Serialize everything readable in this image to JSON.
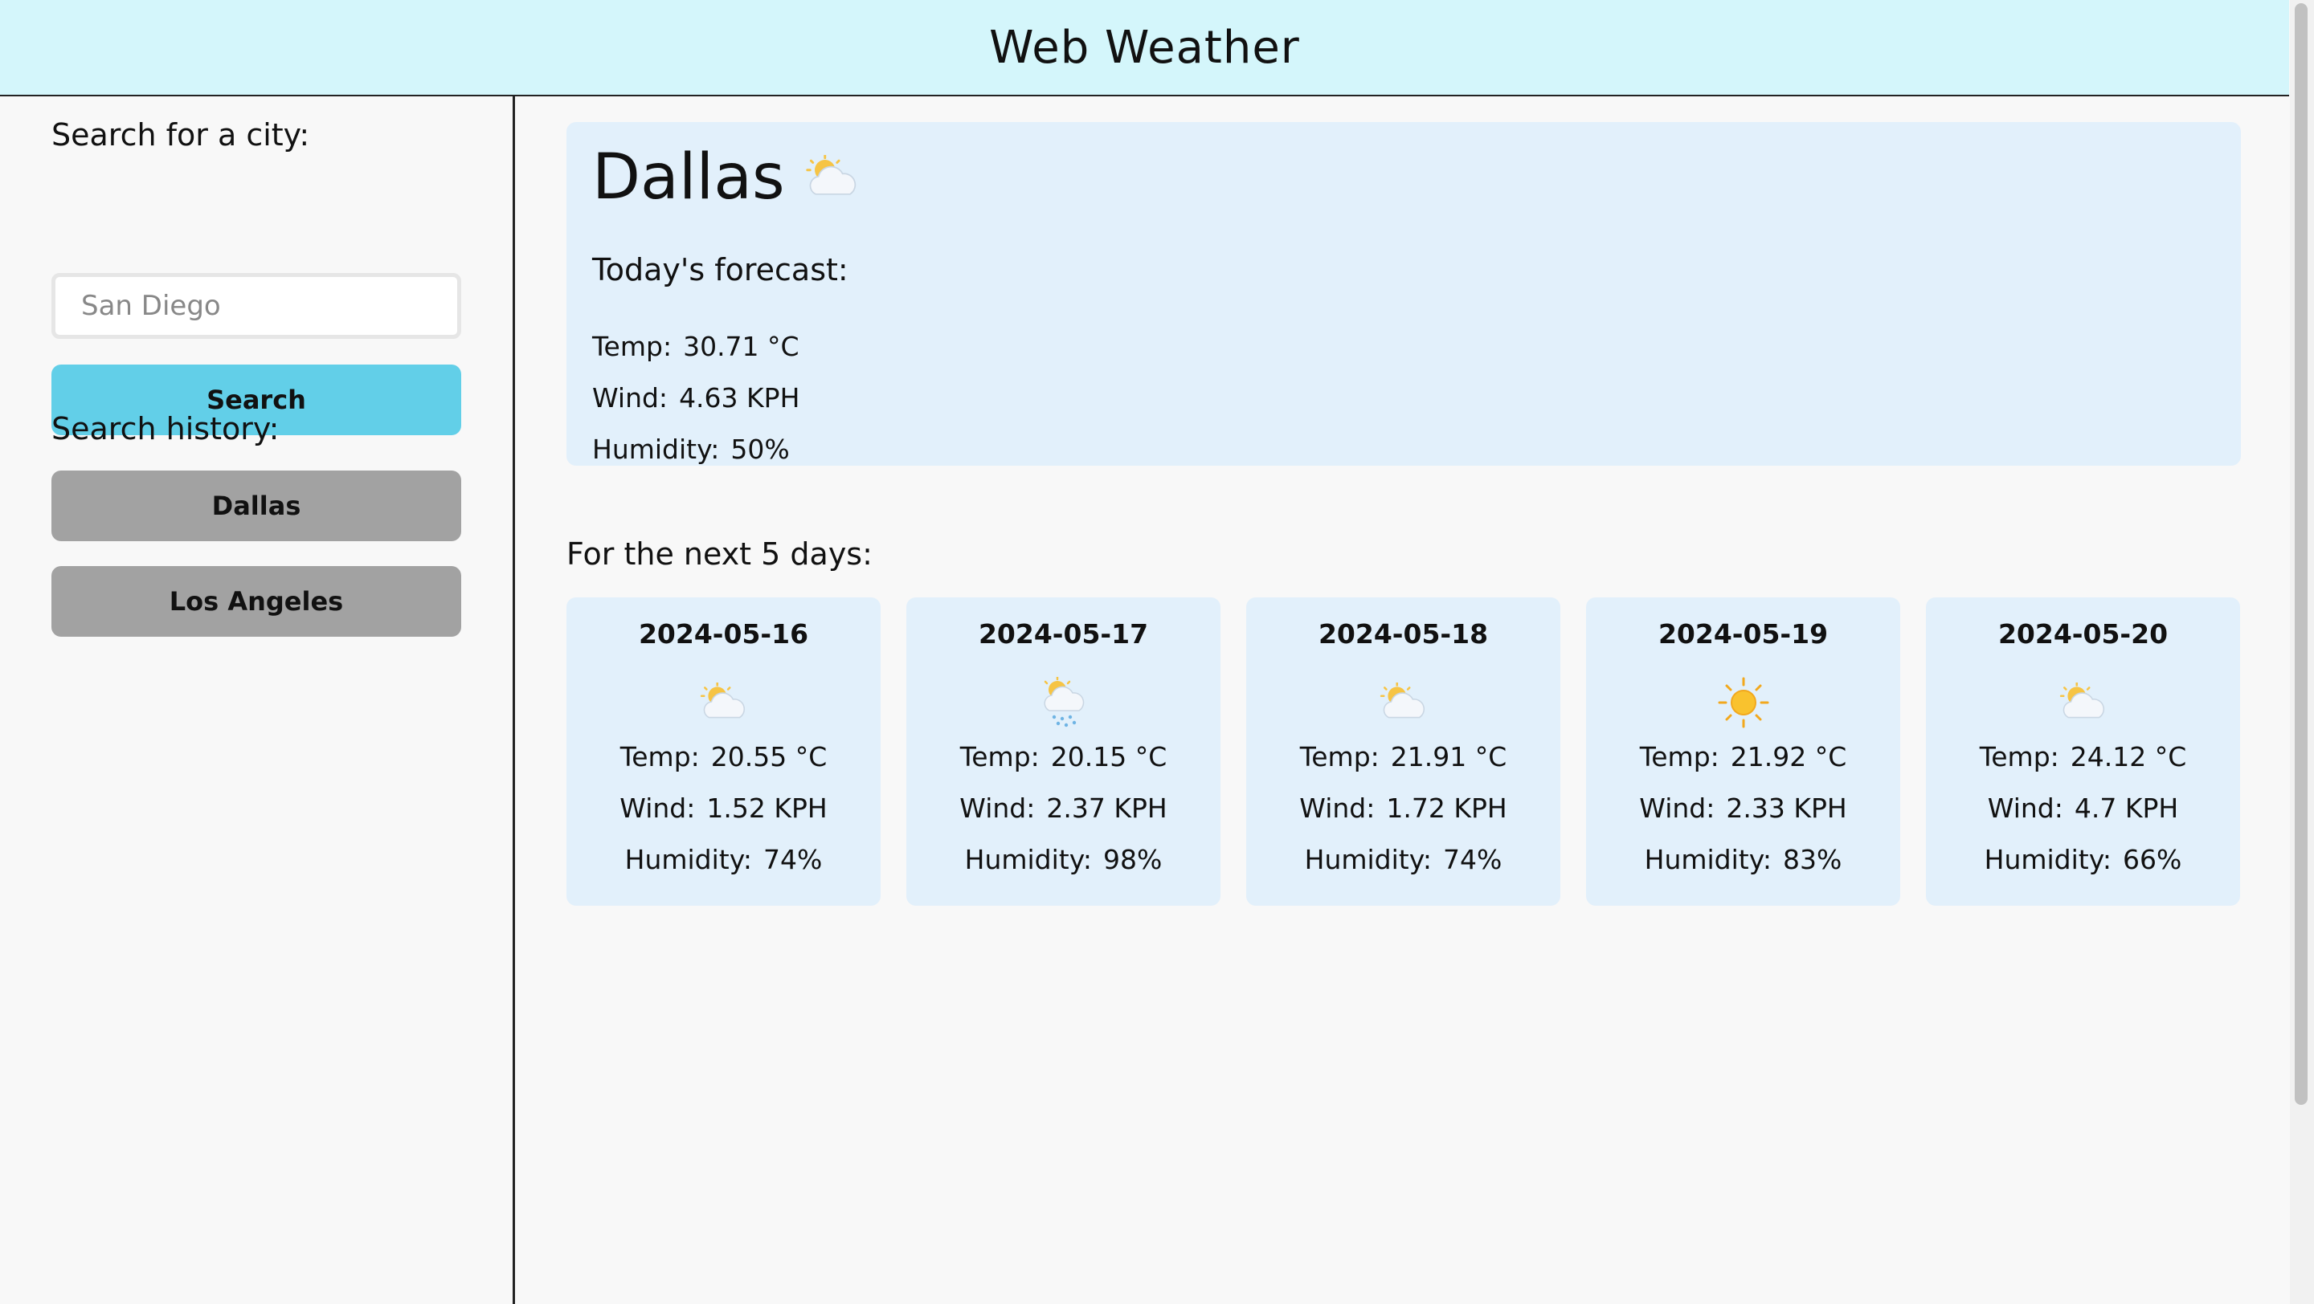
{
  "header": {
    "title": "Web Weather"
  },
  "sidebar": {
    "search_label": "Search for a city:",
    "search_placeholder": "San Diego",
    "search_value": "",
    "search_button": "Search",
    "history_label": "Search history:",
    "history": [
      "Dallas",
      "Los Angeles"
    ]
  },
  "today": {
    "city": "Dallas",
    "icon": "cloud-sun-icon",
    "label": "Today's forecast:",
    "temp_label": "Temp:",
    "temp": "30.71 °C",
    "wind_label": "Wind:",
    "wind": "4.63 KPH",
    "humidity_label": "Humidity:",
    "humidity": "50%"
  },
  "forecast": {
    "label": "For the next 5 days:",
    "temp_label": "Temp:",
    "wind_label": "Wind:",
    "humidity_label": "Humidity:",
    "days": [
      {
        "date": "2024-05-16",
        "icon": "cloud-sun-icon",
        "temp": "20.55 °C",
        "wind": "1.52 KPH",
        "humidity": "74%"
      },
      {
        "date": "2024-05-17",
        "icon": "cloud-sun-rain-icon",
        "temp": "20.15 °C",
        "wind": "2.37 KPH",
        "humidity": "98%"
      },
      {
        "date": "2024-05-18",
        "icon": "cloud-sun-icon",
        "temp": "21.91 °C",
        "wind": "1.72 KPH",
        "humidity": "74%"
      },
      {
        "date": "2024-05-19",
        "icon": "sun-icon",
        "temp": "21.92 °C",
        "wind": "2.33 KPH",
        "humidity": "83%"
      },
      {
        "date": "2024-05-20",
        "icon": "cloud-sun-icon",
        "temp": "24.12 °C",
        "wind": "4.7 KPH",
        "humidity": "66%"
      }
    ]
  }
}
